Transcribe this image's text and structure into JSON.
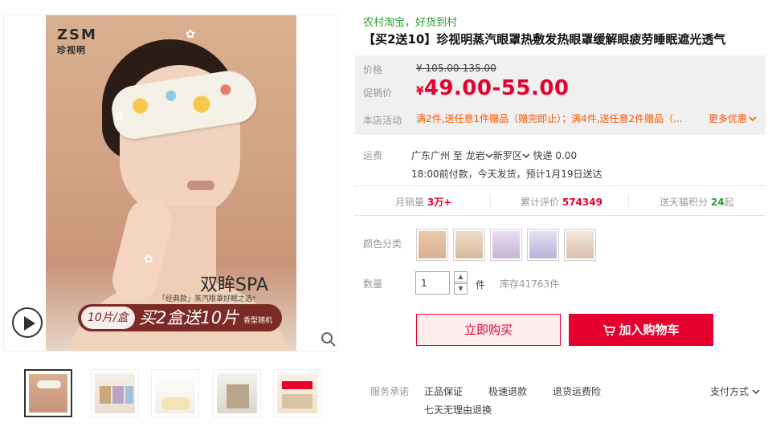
{
  "gallery": {
    "hero_text": {
      "brand_en": "ZSM",
      "brand_cn": "珍视明",
      "spa": "双眸SPA",
      "spa_sub": "「经典款」蒸汽眼罩好眠之选*",
      "pack": "10片/盒",
      "promo": "买2盒送10片",
      "scent": "香型随机"
    },
    "thumbnails": 5,
    "active_thumbnail": 1
  },
  "product": {
    "slogan": "农村淘宝，好货到村",
    "title": "【买2送10】珍视明蒸汽眼罩热敷发热眼罩缓解眼疲劳睡眠遮光透气"
  },
  "price": {
    "orig_label": "价格",
    "orig_currency": "¥",
    "orig_value": "105.00-135.00",
    "promo_label": "促销价",
    "promo_currency": "¥",
    "promo_value": "49.00-55.00",
    "activity_label": "本店活动",
    "activity_text": "满2件,送任意1件赠品（赠完即止）；满4件,送任意2件赠品（...",
    "more_label": "更多优惠"
  },
  "shipping": {
    "label": "运费",
    "from": "广东广州",
    "to_word": "至",
    "region1": "龙岩",
    "region2": "新罗区",
    "method": "快递 0.00",
    "eta": "18:00前付款，今天发货，预计1月19日送达"
  },
  "stats": {
    "monthly_label": "月销量",
    "monthly_value": "3万+",
    "reviews_label": "累计评价",
    "reviews_value": "574349",
    "points_label": "送天猫积分",
    "points_value": "24",
    "points_suffix": "起"
  },
  "sku": {
    "label": "颜色分类",
    "count": 5
  },
  "quantity": {
    "label": "数量",
    "value": "1",
    "unit": "件",
    "stock": "库存41763件"
  },
  "actions": {
    "buy_now": "立即购买",
    "add_cart": "加入购物车"
  },
  "services": {
    "label": "服务承诺",
    "items": [
      "正品保证",
      "极速退款",
      "退货运费险",
      "七天无理由退换"
    ],
    "payment": "支付方式"
  },
  "colors": {
    "accent": "#e5002d",
    "activity": "#ff5500",
    "slogan": "#2a9c2e"
  }
}
